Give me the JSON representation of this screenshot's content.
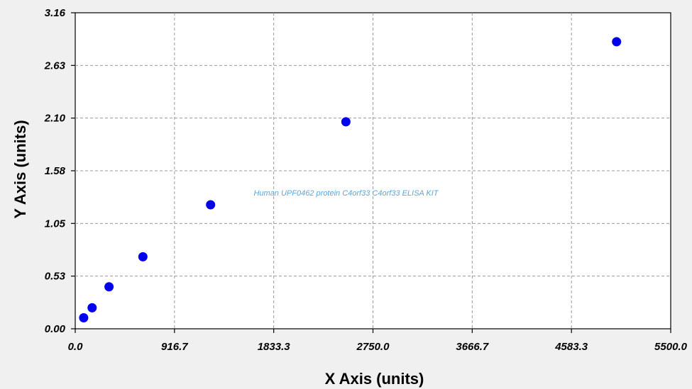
{
  "chart_data": {
    "type": "scatter",
    "title": "",
    "xlabel": "X Axis (units)",
    "ylabel": "Y Axis (units)",
    "xlim": [
      0,
      5500
    ],
    "ylim": [
      0,
      3.16
    ],
    "x_ticks": [
      "0.0",
      "916.7",
      "1833.3",
      "2750.0",
      "3666.7",
      "4583.3",
      "5500.0"
    ],
    "y_ticks": [
      "0.00",
      "0.53",
      "1.05",
      "1.58",
      "2.10",
      "2.63",
      "3.16"
    ],
    "grid": true,
    "annotation": "Human UPF0462 protein C4orf33 C4orf33 ELISA KIT",
    "point_color": "#0000ee",
    "series": [
      {
        "x": [
          78,
          156,
          312,
          625,
          1250,
          2500,
          5000
        ],
        "y": [
          0.11,
          0.21,
          0.42,
          0.72,
          1.24,
          2.07,
          2.87
        ]
      }
    ]
  }
}
